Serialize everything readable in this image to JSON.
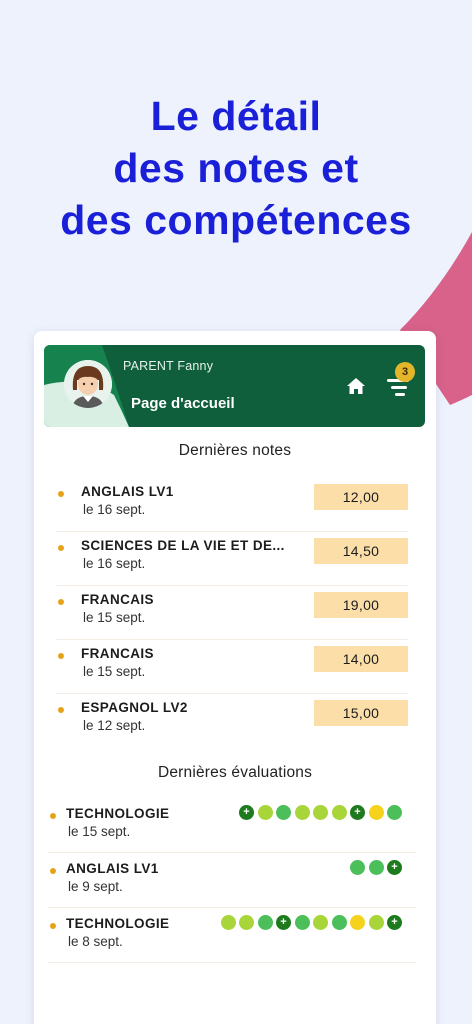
{
  "headline": {
    "line1": "Le détail",
    "line2": "des notes et",
    "line3": "des compétences"
  },
  "header": {
    "parent_name": "PARENT Fanny",
    "page_title": "Page d'accueil",
    "home_icon": "home-icon",
    "menu_icon": "menu-icon",
    "badge_count": "3"
  },
  "notes": {
    "title": "Dernières notes",
    "items": [
      {
        "subject": "ANGLAIS LV1",
        "date": "le 16 sept.",
        "grade": "12,00"
      },
      {
        "subject": "SCIENCES DE LA VIE ET DE...",
        "date": "le 16 sept.",
        "grade": "14,50"
      },
      {
        "subject": "FRANCAIS",
        "date": "le 15 sept.",
        "grade": "19,00"
      },
      {
        "subject": "FRANCAIS",
        "date": "le 15 sept.",
        "grade": "14,00"
      },
      {
        "subject": "ESPAGNOL LV2",
        "date": "le 12 sept.",
        "grade": "15,00"
      }
    ]
  },
  "evaluations": {
    "title": "Dernières évaluations",
    "items": [
      {
        "subject": "TECHNOLOGIE",
        "date": "le 15 sept.",
        "skills": [
          "plus",
          "light",
          "green",
          "light",
          "light",
          "light",
          "plus",
          "yellow",
          "green"
        ]
      },
      {
        "subject": "ANGLAIS LV1",
        "date": "le 9 sept.",
        "skills": [
          "green",
          "green",
          "plus"
        ]
      },
      {
        "subject": "TECHNOLOGIE",
        "date": "le 8 sept.",
        "skills": [
          "light",
          "light",
          "green",
          "plus",
          "green",
          "light",
          "green",
          "yellow",
          "light",
          "plus"
        ]
      }
    ]
  },
  "colors": {
    "headline": "#1a1fd8",
    "header_bg": "#0f5e3c",
    "grade_bg": "#fcdfa8",
    "bullet": "#e8a11a",
    "skill_plus": "#1d7a1d",
    "skill_light": "#a8d63a",
    "skill_green": "#4cbf5b",
    "skill_yellow": "#f5d21b"
  }
}
